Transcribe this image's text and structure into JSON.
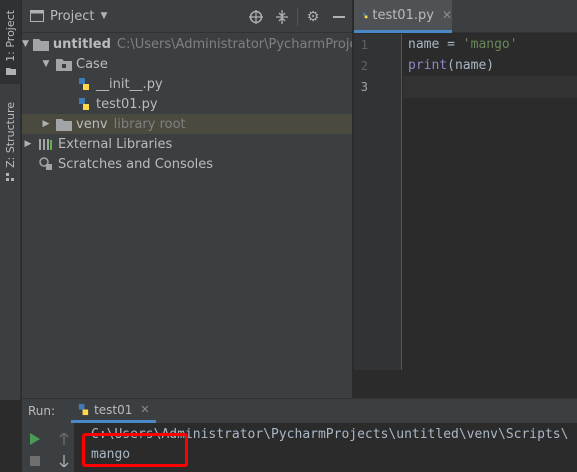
{
  "stripe": {
    "project_tab": "1: Project",
    "structure_tab": "Z: Structure"
  },
  "project_panel": {
    "title": "Project",
    "tree": [
      {
        "label": "untitled",
        "path": "C:\\Users\\Administrator\\PycharmProjects\\untitled",
        "bold": true
      },
      {
        "label": "Case"
      },
      {
        "label": "__init__.py"
      },
      {
        "label": "test01.py"
      },
      {
        "label": "venv",
        "path": "library root"
      },
      {
        "label": "External Libraries"
      },
      {
        "label": "Scratches and Consoles"
      }
    ]
  },
  "editor": {
    "tab_label": "test01.py",
    "line_numbers": [
      "1",
      "2",
      "3"
    ],
    "code": {
      "line1_var": "name = ",
      "line1_str": "'mango'",
      "line2_kw": "print",
      "line2_rest": "(name)"
    }
  },
  "run_panel": {
    "label": "Run:",
    "tab_label": "test01",
    "console_lines": [
      "C:\\Users\\Administrator\\PycharmProjects\\untitled\\venv\\Scripts\\",
      "mango"
    ]
  },
  "colors": {
    "accent": "#4a88c7",
    "highlight_box": "#ff0000",
    "run_green": "#499c54"
  }
}
